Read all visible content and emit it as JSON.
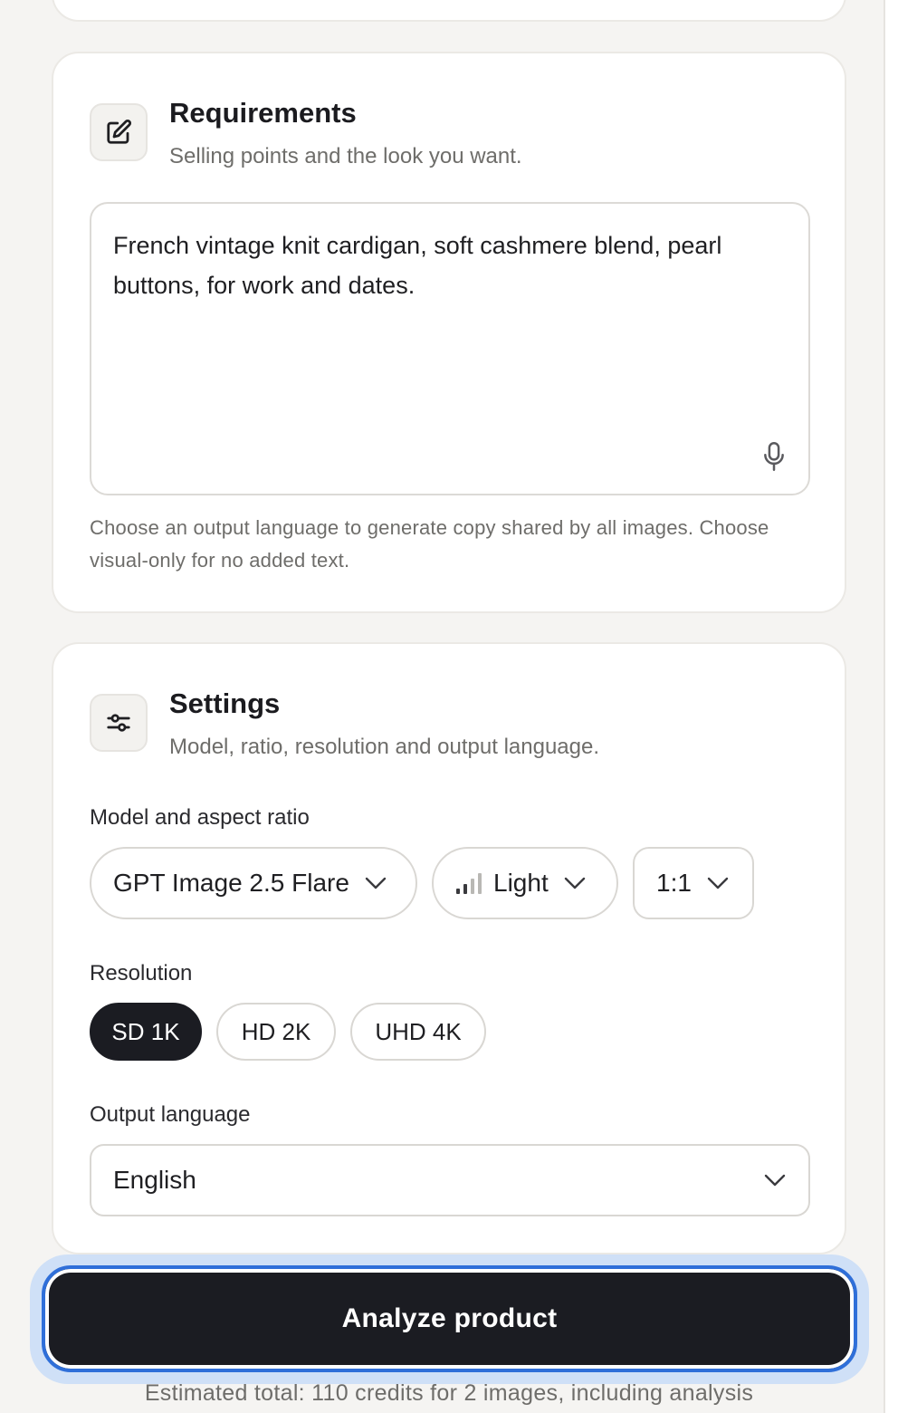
{
  "requirements": {
    "title": "Requirements",
    "subtitle": "Selling points and the look you want.",
    "text": "French vintage knit cardigan, soft cashmere blend, pearl buttons, for work and dates.",
    "hint": "Choose an output language to generate copy shared by all images. Choose visual-only for no added text.",
    "icon": "edit-icon"
  },
  "settings": {
    "title": "Settings",
    "subtitle": "Model, ratio, resolution and output language.",
    "icon": "sliders-icon",
    "model_label": "Model and aspect ratio",
    "model_value": "GPT Image 2.5 Flare",
    "quality_value": "Light",
    "ratio_value": "1:1",
    "resolution_label": "Resolution",
    "resolutions": [
      "SD 1K",
      "HD 2K",
      "UHD 4K"
    ],
    "resolution_selected": "SD 1K",
    "language_label": "Output language",
    "language_value": "English"
  },
  "action": {
    "analyze_label": "Analyze product",
    "estimate": "Estimated total: 110 credits for 2 images, including analysis"
  },
  "colors": {
    "accent": "#2f6fd9",
    "primary_dark": "#1b1c22",
    "background": "#f5f4f2"
  }
}
